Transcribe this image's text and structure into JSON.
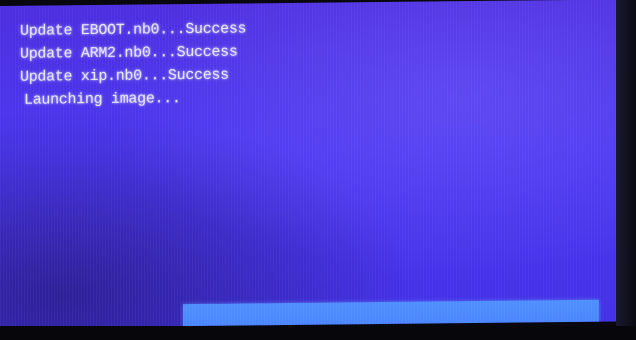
{
  "boot_log": {
    "lines": [
      "Update EBOOT.nb0...Success",
      "Update ARM2.nb0...Success",
      "Update xip.nb0...Success",
      "Launching image..."
    ]
  },
  "progress": {
    "fraction": 1.0
  },
  "colors": {
    "screen_background": "#4a36f0",
    "text": "#e9e6ff",
    "progress_fill": "#4a86ff"
  }
}
